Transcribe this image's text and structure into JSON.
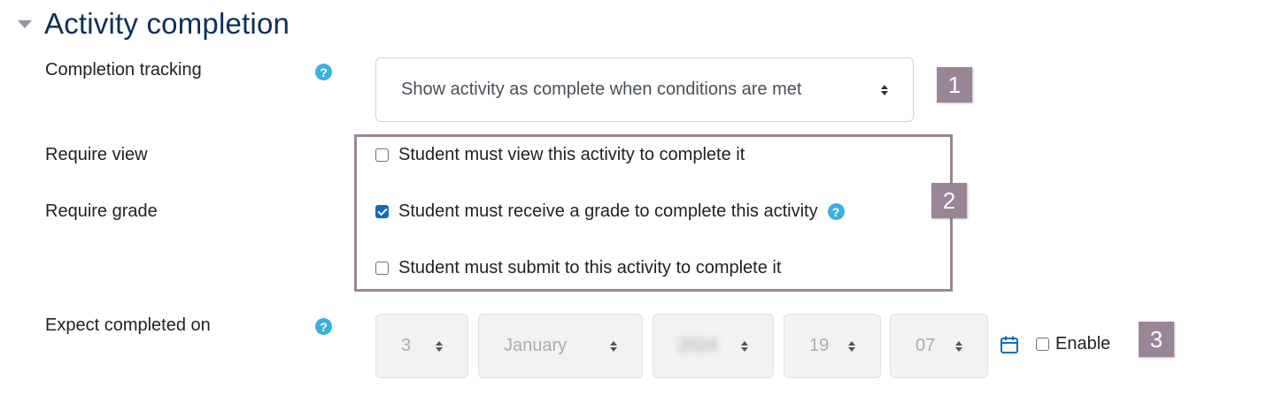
{
  "section": {
    "title": "Activity completion"
  },
  "completion_tracking": {
    "label": "Completion tracking",
    "value": "Show activity as complete when conditions are met",
    "badge": "1"
  },
  "require_view": {
    "label": "Require view",
    "checkbox_label": "Student must view this activity to complete it",
    "checked": false
  },
  "require_grade": {
    "label": "Require grade",
    "checkbox_label": "Student must receive a grade to complete this activity",
    "checked": true,
    "badge": "2"
  },
  "require_submit": {
    "checkbox_label": "Student must submit to this activity to complete it",
    "checked": false
  },
  "expect_completed": {
    "label": "Expect completed on",
    "day": "3",
    "month": "January",
    "year": "2024",
    "hour": "19",
    "minute": "07",
    "enable_label": "Enable",
    "enabled": false,
    "badge": "3"
  },
  "icons": {
    "help": "?"
  },
  "colors": {
    "title": "#0f2f57",
    "help_icon": "#3ab0dc",
    "badge": "#9a8597",
    "checkbox_checked": "#0f6cbf",
    "calendar_icon": "#0f6cbf"
  }
}
